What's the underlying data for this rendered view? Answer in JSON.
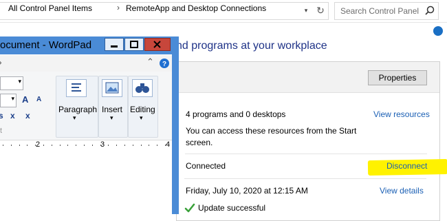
{
  "address_bar": {
    "crumbs": [
      "All Control Panel Items",
      "RemoteApp and Desktop Connections"
    ],
    "search_placeholder": "Search Control Panel"
  },
  "page": {
    "heading": "nd programs at your workplace",
    "properties_button": "Properties"
  },
  "connection": {
    "summary": "4 programs and 0 desktops",
    "view_resources": "View resources",
    "access_line1": "You can access these resources from the Start",
    "access_line2": "screen.",
    "status": "Connected",
    "disconnect": "Disconnect",
    "updated": "Friday, July 10, 2020 at 12:15 AM",
    "view_details": "View details",
    "update_status": "Update successful",
    "highlight_color": "#fff200"
  },
  "wordpad": {
    "title": "ocument - WordPad",
    "groups": [
      "Paragraph",
      "Insert",
      "Editing"
    ],
    "ruler_numbers": [
      "2",
      "3",
      "4"
    ],
    "faded_label": "t",
    "font_glyphs": {
      "grow": "A",
      "shrink": "A",
      "subscript": "x",
      "superscript": "x",
      "strike_partial": "s"
    }
  }
}
